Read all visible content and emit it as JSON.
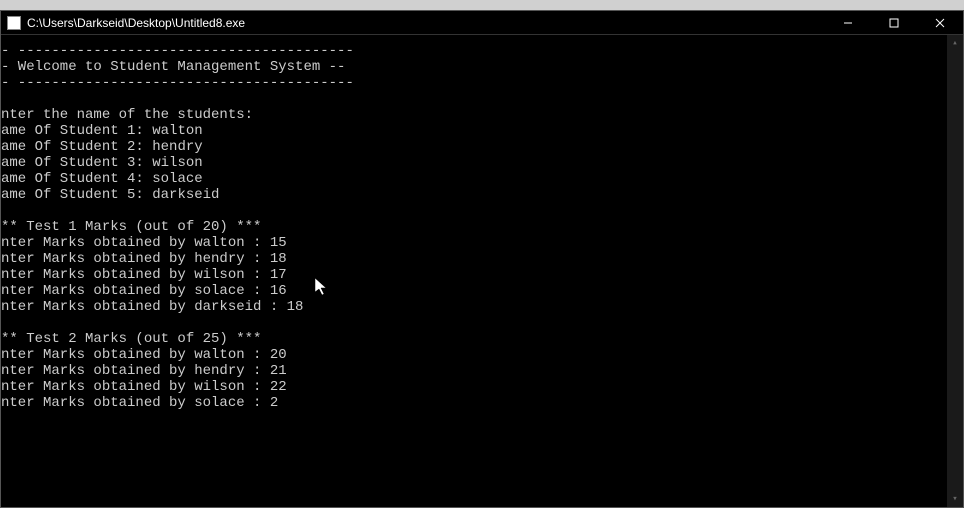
{
  "window": {
    "title": "C:\\Users\\Darkseid\\Desktop\\Untitled8.exe"
  },
  "console": {
    "divider1": "- ----------------------------------------",
    "welcome": "- Welcome to Student Management System --",
    "divider2": "- ----------------------------------------",
    "enter_names_prompt": "nter the name of the students:",
    "students": [
      {
        "label": "ame Of Student 1: ",
        "name": "walton"
      },
      {
        "label": "ame Of Student 2: ",
        "name": "hendry"
      },
      {
        "label": "ame Of Student 3: ",
        "name": "wilson"
      },
      {
        "label": "ame Of Student 4: ",
        "name": "solace"
      },
      {
        "label": "ame Of Student 5: ",
        "name": "darkseid"
      }
    ],
    "test1_header": "** Test 1 Marks (out of 20) ***",
    "test1_marks": [
      {
        "label": "nter Marks obtained by walton : ",
        "value": "15"
      },
      {
        "label": "nter Marks obtained by hendry : ",
        "value": "18"
      },
      {
        "label": "nter Marks obtained by wilson : ",
        "value": "17"
      },
      {
        "label": "nter Marks obtained by solace : ",
        "value": "16"
      },
      {
        "label": "nter Marks obtained by darkseid : ",
        "value": "18"
      }
    ],
    "test2_header": "** Test 2 Marks (out of 25) ***",
    "test2_marks": [
      {
        "label": "nter Marks obtained by walton : ",
        "value": "20"
      },
      {
        "label": "nter Marks obtained by hendry : ",
        "value": "21"
      },
      {
        "label": "nter Marks obtained by wilson : ",
        "value": "22"
      },
      {
        "label": "nter Marks obtained by solace : ",
        "value": "2"
      }
    ]
  }
}
